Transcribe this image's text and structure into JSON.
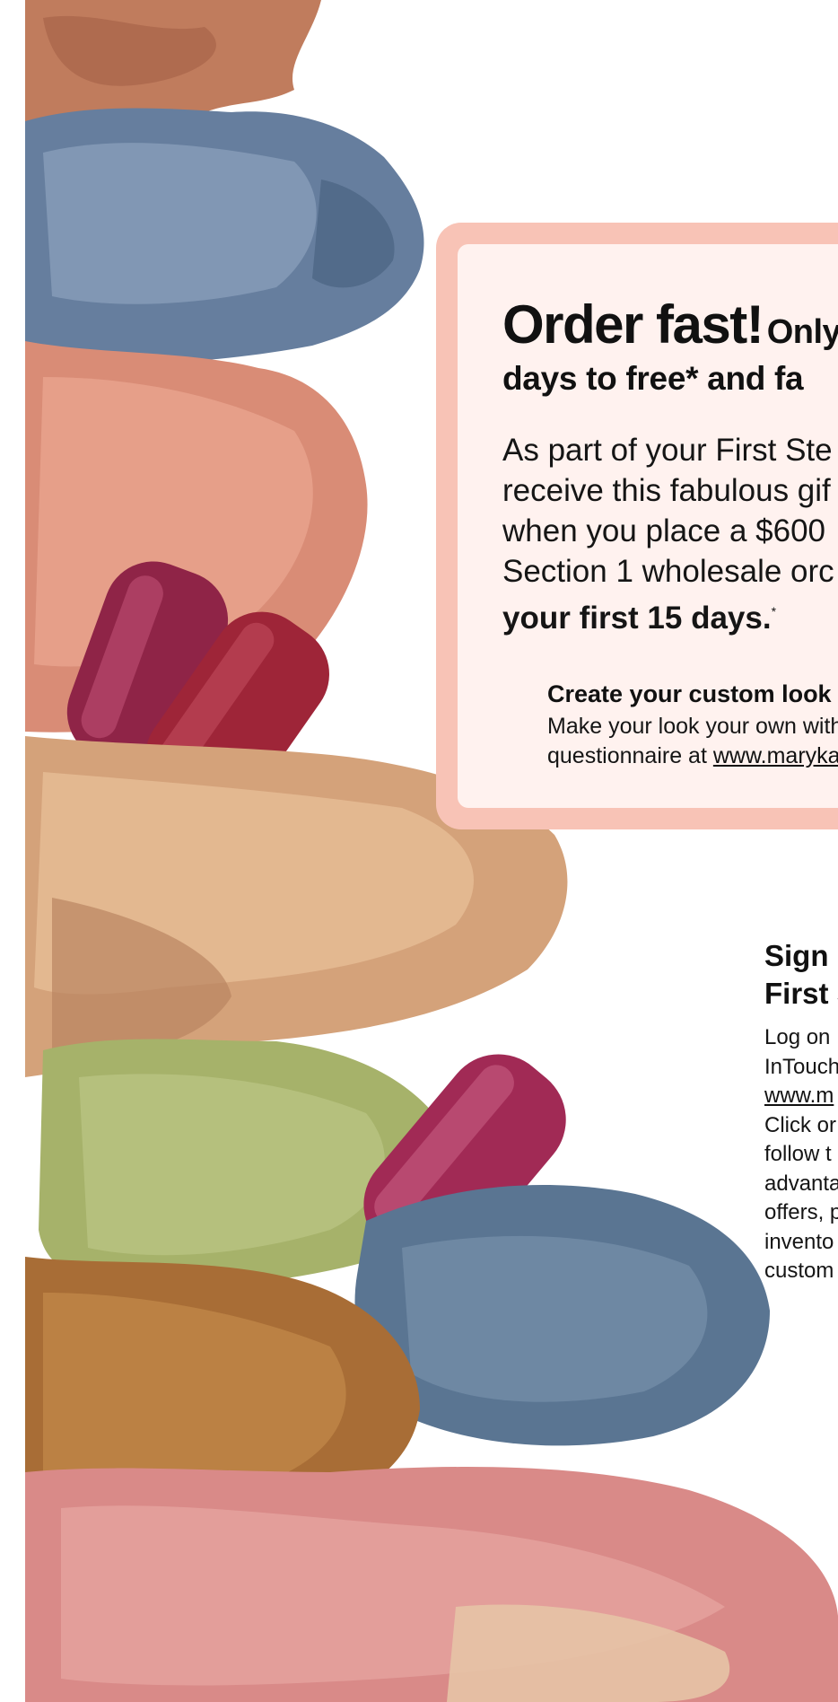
{
  "promo": {
    "headline_big": "Order fast!",
    "headline_small": "Only",
    "headline_line2": "days to free* and fa",
    "body_lines": [
      "As part of your First Ste",
      "receive this fabulous gif",
      "when you place a $600",
      "Section 1 wholesale orc"
    ],
    "body_bold": "your first 15 days.",
    "body_asterisk": "*",
    "custom_look_title": "Create your custom look",
    "custom_look_text": "Make your look your own with",
    "custom_look_text2": "questionnaire at ",
    "custom_look_link": "www.maryka"
  },
  "signup": {
    "title_line1": "Sign u",
    "title_line2": "First S",
    "lines": [
      "Log on",
      "InTouch"
    ],
    "link": "www.m",
    "lines2": [
      "Click or",
      "follow t",
      "advanta",
      "offers, p",
      "invento",
      "custom"
    ]
  },
  "colors": {
    "card_border": "#f8c3b6",
    "card_fill": "#fff2ef"
  },
  "icons": [
    "eyeshadow-swatches-illustration",
    "lipstick-illustration"
  ]
}
